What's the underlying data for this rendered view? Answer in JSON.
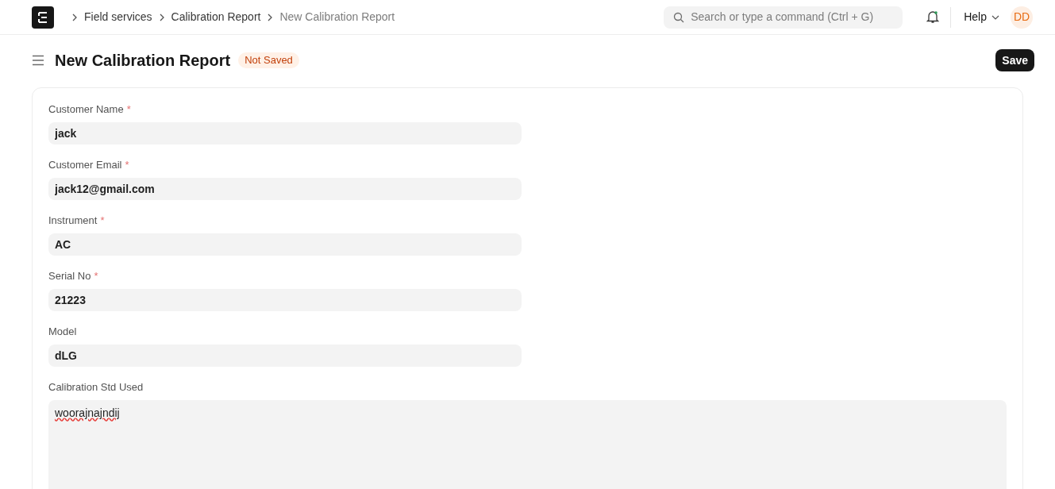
{
  "navbar": {
    "breadcrumbs": [
      {
        "label": "Field services",
        "current": false
      },
      {
        "label": "Calibration Report",
        "current": false
      },
      {
        "label": "New Calibration Report",
        "current": true
      }
    ],
    "search": {
      "placeholder": "Search or type a command (Ctrl + G)"
    },
    "help": "Help",
    "avatar": "DD"
  },
  "page": {
    "title": "New Calibration Report",
    "status": "Not Saved",
    "save": "Save"
  },
  "form": {
    "fields": [
      {
        "kind": "input",
        "label": "Customer Name",
        "marker": "*",
        "value": "jack"
      },
      {
        "kind": "input",
        "label": "Customer Email",
        "marker": "*",
        "value": "jack12@gmail.com"
      },
      {
        "kind": "input",
        "label": "Instrument",
        "marker": "*",
        "value": "AC"
      },
      {
        "kind": "input",
        "label": "Serial No",
        "marker": "*",
        "value": "21223"
      },
      {
        "kind": "input",
        "label": "Model",
        "value": "dLG"
      },
      {
        "kind": "textarea",
        "label": "Calibration Std Used",
        "value": "woorajnajndij"
      }
    ]
  }
}
